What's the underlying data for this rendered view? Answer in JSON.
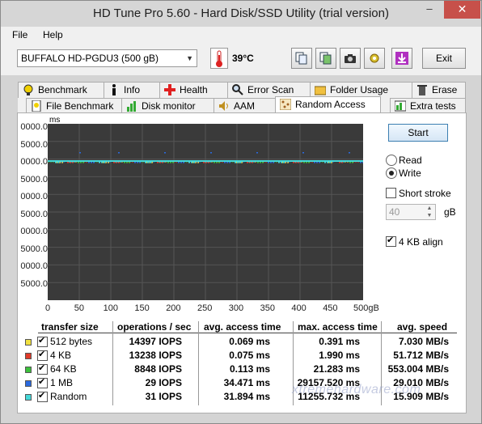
{
  "window": {
    "title": "HD Tune Pro 5.60 - Hard Disk/SSD Utility (trial version)",
    "minimize": "–",
    "close": "✕"
  },
  "menu": {
    "file": "File",
    "help": "Help"
  },
  "toolbar": {
    "drive": "BUFFALO HD-PGDU3 (500 gB)",
    "temperature": "39°C",
    "exit_label": "Exit"
  },
  "tabs_top": [
    "Benchmark",
    "Info",
    "Health",
    "Error Scan",
    "Folder Usage",
    "Erase"
  ],
  "tabs_bottom": [
    "File Benchmark",
    "Disk monitor",
    "AAM",
    "Random Access",
    "Extra tests"
  ],
  "active_tab": "Random Access",
  "chart": {
    "unit": "ms",
    "y_ticks": [
      "0000.0",
      "5000.0",
      "0000.0",
      "5000.0",
      "0000.0",
      "5000.0",
      "0000.0",
      "5000.0",
      "0000.0",
      "5000.0"
    ],
    "x_ticks": [
      "0",
      "50",
      "100",
      "150",
      "200",
      "250",
      "300",
      "350",
      "400",
      "450",
      "500gB"
    ]
  },
  "chart_data": {
    "type": "scatter",
    "xlabel": "",
    "ylabel": "ms",
    "xlim": [
      0,
      500
    ],
    "series": [
      {
        "name": "512 bytes",
        "color": "#f0e040",
        "level": 0.069
      },
      {
        "name": "4 KB",
        "color": "#e03a2a",
        "level": 0.075
      },
      {
        "name": "64 KB",
        "color": "#3cc03c",
        "level": 0.113
      },
      {
        "name": "1 MB",
        "color": "#2a6adf",
        "level": 34.471
      },
      {
        "name": "Random",
        "color": "#44d8d8",
        "level": 31.894
      }
    ]
  },
  "controls": {
    "start_label": "Start",
    "read_label": "Read",
    "write_label": "Write",
    "short_stroke_label": "Short stroke",
    "gb_value": "40",
    "gb_unit": "gB",
    "align_label": "4 KB align"
  },
  "results": {
    "headers": [
      "transfer size",
      "operations / sec",
      "avg. access time",
      "max. access time",
      "avg. speed"
    ],
    "rows": [
      {
        "color": "#f0e040",
        "size": "512 bytes",
        "ops": "14397 IOPS",
        "avg": "0.069 ms",
        "max": "0.391 ms",
        "speed": "7.030 MB/s"
      },
      {
        "color": "#e03a2a",
        "size": "4 KB",
        "ops": "13238 IOPS",
        "avg": "0.075 ms",
        "max": "1.990 ms",
        "speed": "51.712 MB/s"
      },
      {
        "color": "#3cc03c",
        "size": "64 KB",
        "ops": "8848 IOPS",
        "avg": "0.113 ms",
        "max": "21.283 ms",
        "speed": "553.004 MB/s"
      },
      {
        "color": "#2a6adf",
        "size": "1 MB",
        "ops": "29 IOPS",
        "avg": "34.471 ms",
        "max": "29157.520 ms",
        "speed": "29.010 MB/s"
      },
      {
        "color": "#44d8d8",
        "size": "Random",
        "ops": "31 IOPS",
        "avg": "31.894 ms",
        "max": "11255.732 ms",
        "speed": "15.909 MB/s"
      }
    ]
  },
  "watermark": "xtremehardware.com"
}
